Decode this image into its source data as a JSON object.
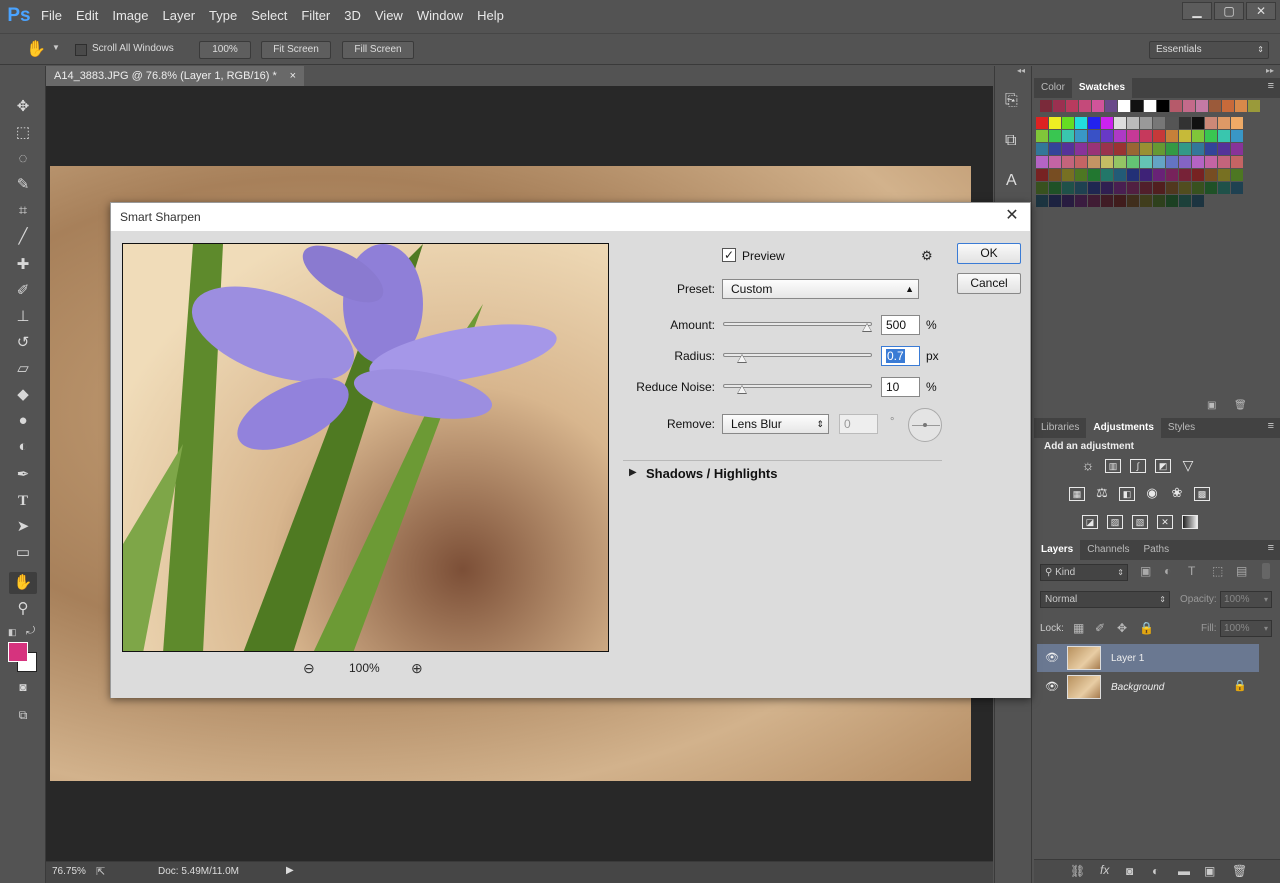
{
  "app": {
    "logo": "Ps"
  },
  "menu": [
    "File",
    "Edit",
    "Image",
    "Layer",
    "Type",
    "Select",
    "Filter",
    "3D",
    "View",
    "Window",
    "Help"
  ],
  "window_controls": {
    "minimize": "▁",
    "restore": "▢",
    "close": "✕"
  },
  "options": {
    "scroll_all_windows": "Scroll All Windows",
    "zoom_100": "100%",
    "fit_screen": "Fit Screen",
    "fill_screen": "Fill Screen",
    "workspace": "Essentials"
  },
  "document": {
    "tab_title": "A14_3883.JPG @ 76.8% (Layer 1, RGB/16) *",
    "tab_close": "×",
    "zoom": "76.75%",
    "doc_size": "Doc: 5.49M/11.0M"
  },
  "dialog": {
    "title": "Smart Sharpen",
    "close": "✕",
    "preview_label": "Preview",
    "preset_label": "Preset:",
    "preset_value": "Custom",
    "amount_label": "Amount:",
    "amount_value": "500",
    "amount_unit": "%",
    "amount_level": 1.0,
    "radius_label": "Radius:",
    "radius_value": "0.7",
    "radius_unit": "px",
    "radius_level": 0.1,
    "noise_label": "Reduce Noise:",
    "noise_value": "10",
    "noise_unit": "%",
    "noise_level": 0.1,
    "remove_label": "Remove:",
    "remove_value": "Lens Blur",
    "angle_value": "0",
    "angle_unit": "°",
    "shadows_label": "Shadows / Highlights",
    "ok": "OK",
    "cancel": "Cancel",
    "preview_zoom": "100%"
  },
  "panels": {
    "color_tabs": [
      "Color",
      "Swatches"
    ],
    "adjust_tabs": [
      "Libraries",
      "Adjustments",
      "Styles"
    ],
    "add_adjustment": "Add an adjustment",
    "layer_tabs": [
      "Layers",
      "Channels",
      "Paths"
    ],
    "kind_label": "Kind",
    "blend_mode": "Normal",
    "opacity_label": "Opacity:",
    "opacity_value": "100%",
    "lock_label": "Lock:",
    "fill_label": "Fill:",
    "fill_value": "100%"
  },
  "layers": [
    {
      "name": "Layer 1",
      "selected": true
    },
    {
      "name": "Background",
      "selected": false
    }
  ],
  "colors": {
    "foreground": "#d6337e",
    "background": "#ffffff",
    "accent": "#4aa3ff"
  }
}
